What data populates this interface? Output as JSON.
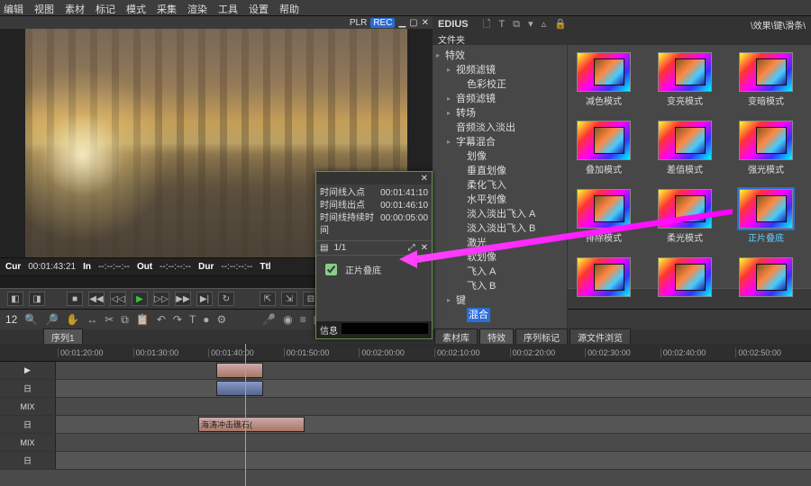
{
  "menubar": [
    "编辑",
    "视图",
    "素材",
    "标记",
    "模式",
    "采集",
    "渲染",
    "工具",
    "设置",
    "帮助"
  ],
  "preview": {
    "plr_label": "PLR",
    "rec_label": "REC",
    "cur_label": "Cur",
    "cur_tc": "00:01:43:21",
    "in_label": "In",
    "in_tc": "--:--:--:--",
    "out_label": "Out",
    "out_tc": "--:--:--:--",
    "dur_label": "Dur",
    "dur_tc": "--:--:--:--",
    "ttl_label": "Ttl"
  },
  "right": {
    "app": "EDIUS",
    "crumb": "\\效果\\键\\滑条\\",
    "folder_label": "文件夹"
  },
  "tree": {
    "root": "特效",
    "videoFilters": "视频滤镜",
    "colorCorrect": "色彩校正",
    "audioFilters": "音频滤镜",
    "transitions": "转场",
    "audioFade": "音频淡入淡出",
    "subtitleMix": "字幕混合",
    "wipe": "划像",
    "vertWipe": "垂直划像",
    "softFlyin": "柔化飞入",
    "horizWipe": "水平划像",
    "fadeFlyA": "淡入淡出飞入 A",
    "fadeFlyB": "淡入淡出飞入 B",
    "laser": "激光",
    "softWipe": "软划像",
    "flyA": "飞入 A",
    "flyB": "飞入 B",
    "keys": "键",
    "mix": "混合"
  },
  "thumbs": [
    {
      "label": "减色模式"
    },
    {
      "label": "变亮模式"
    },
    {
      "label": "变暗模式"
    },
    {
      "label": "叠加模式"
    },
    {
      "label": "差值模式"
    },
    {
      "label": "强光模式"
    },
    {
      "label": "排除模式"
    },
    {
      "label": "柔光模式"
    },
    {
      "label": "正片叠底",
      "selected": true
    },
    {
      "label": ""
    },
    {
      "label": ""
    },
    {
      "label": ""
    }
  ],
  "tabs": [
    "素材库",
    "特效",
    "序列标记",
    "源文件浏览"
  ],
  "toolbar2_seq": "序列1",
  "ruler": [
    "00:01:20:00",
    "00:01:30:00",
    "00:01:40:00",
    "00:01:50:00",
    "00:02:00:00",
    "00:02:10:00",
    "00:02:20:00",
    "00:02:30:00",
    "00:02:40:00",
    "00:02:50:00"
  ],
  "tracks": {
    "t1": "▶",
    "t2": "日",
    "t3": "MIX",
    "t4": "日",
    "t5": "MIX",
    "t6": "日",
    "clip_label": "海涛冲击礁石("
  },
  "info": {
    "r1k": "时间线入点",
    "r1v": "00:01:41:10",
    "r2k": "时间线出点",
    "r2v": "00:01:46:10",
    "r3k": "时间线持续时间",
    "r3v": "00:00:05:00",
    "nav": "1/1",
    "check": "正片叠底",
    "foot": "信息"
  },
  "side_label": "12"
}
